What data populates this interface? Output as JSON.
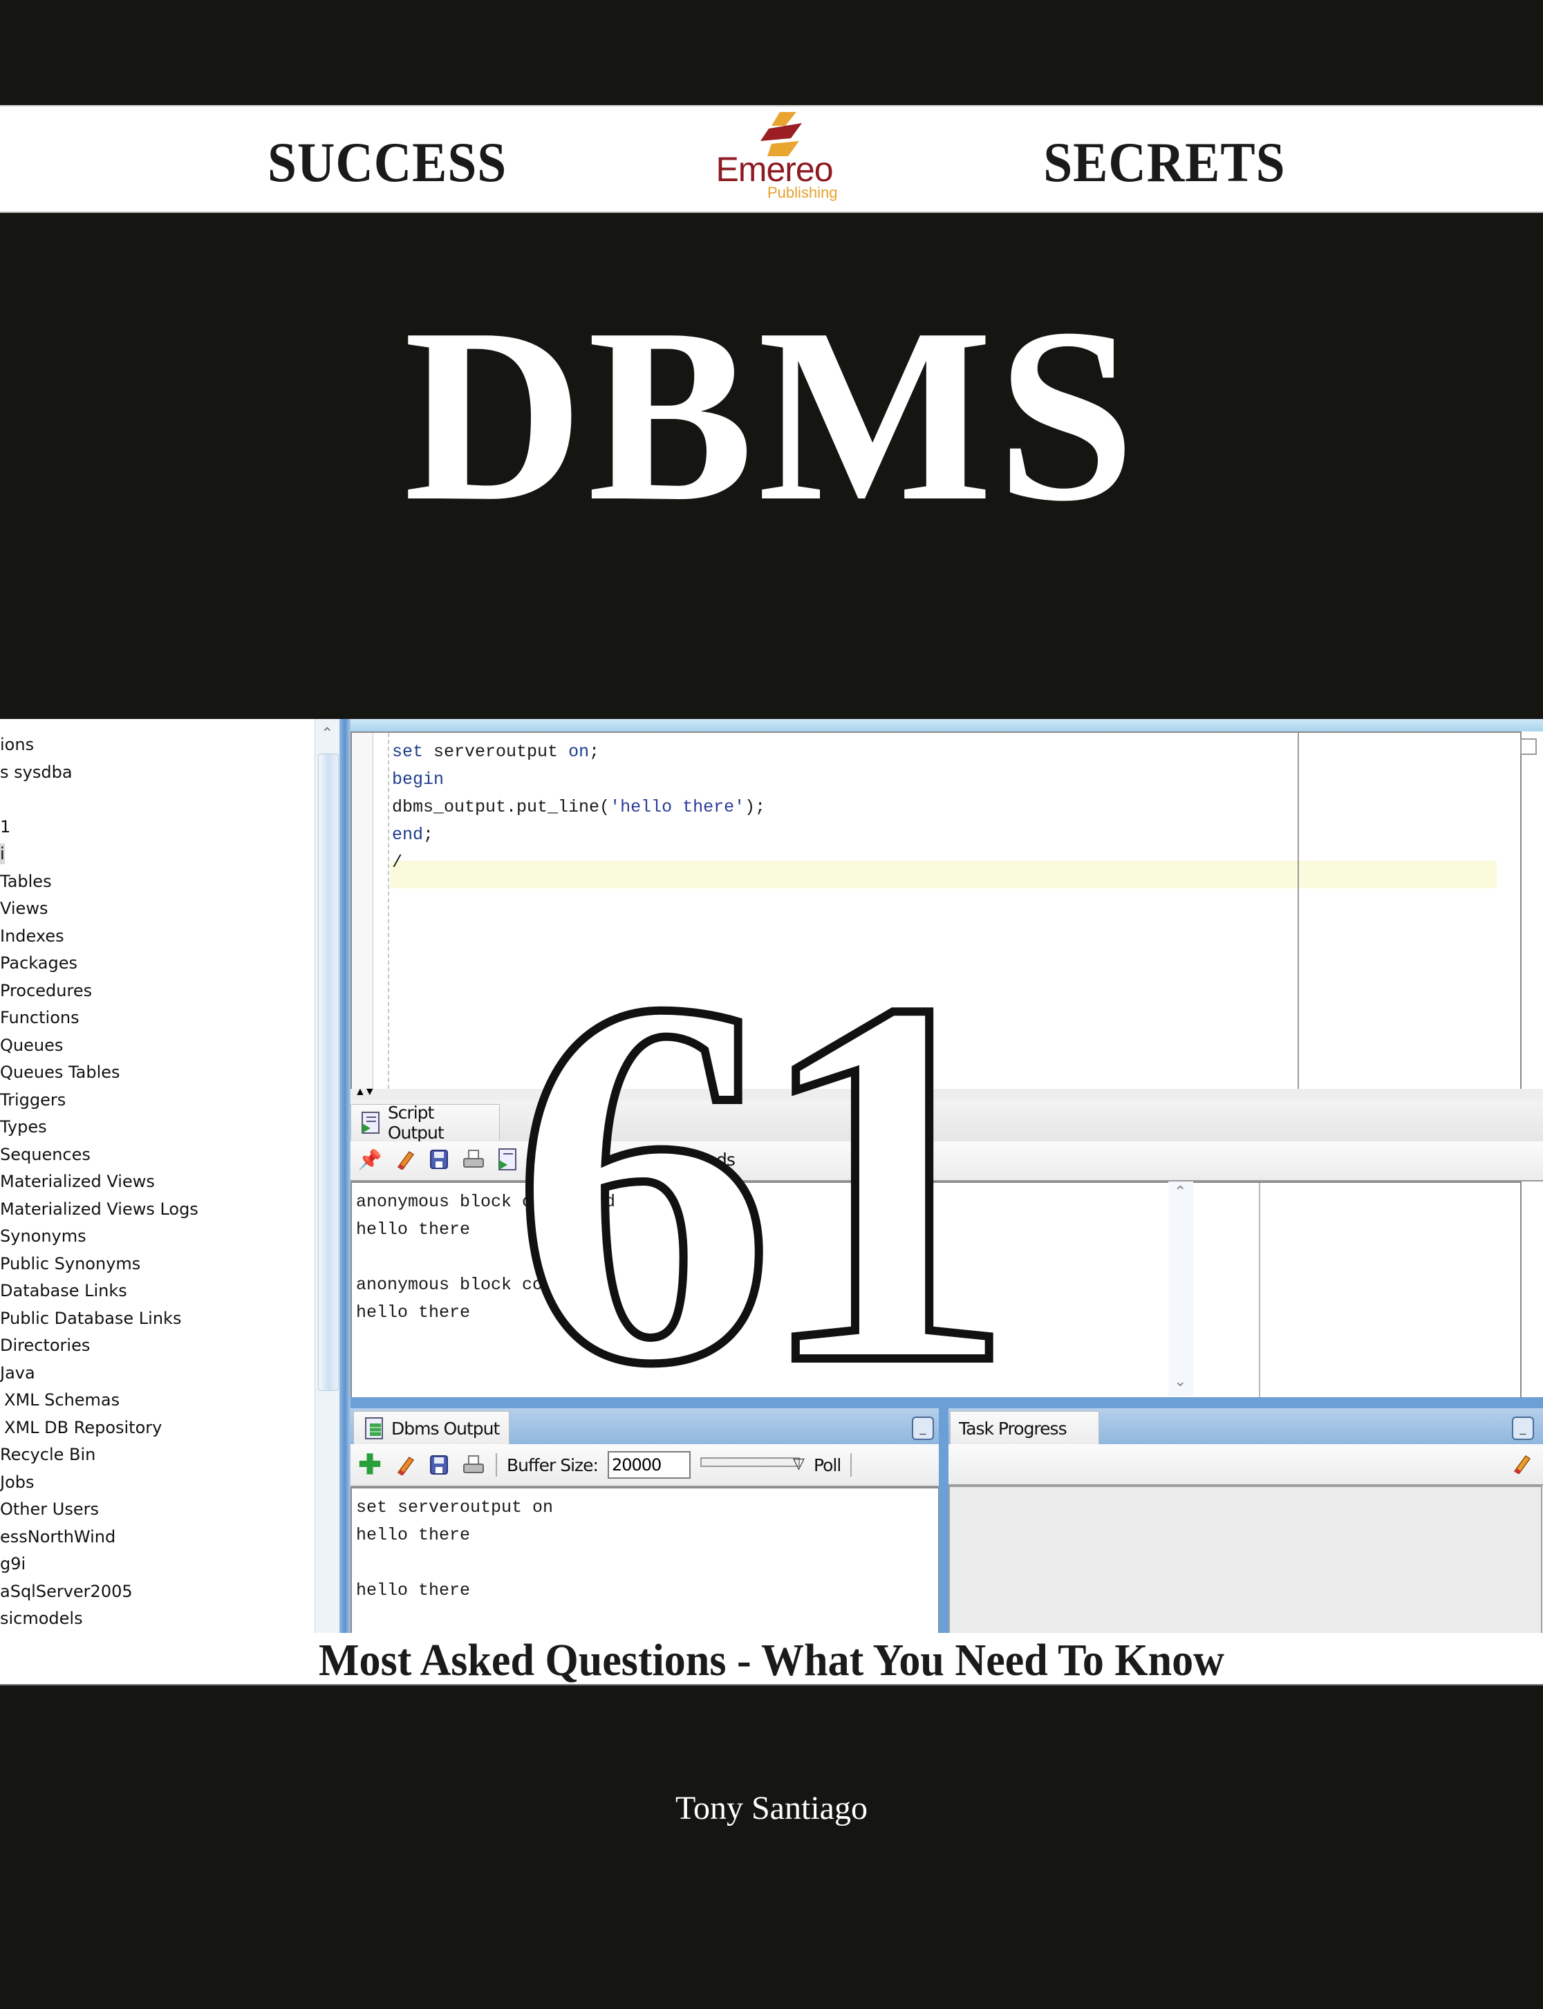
{
  "banner": {
    "left_word": "SUCCESS",
    "right_word": "SECRETS",
    "logo": {
      "name": "Emereo",
      "sub": "Publishing",
      "icon": "flame-stripes-logo",
      "colors": {
        "primary": "#8e1a22",
        "accent": "#e6a12c"
      }
    }
  },
  "title": "DBMS",
  "number": "61",
  "subtitle": "Most Asked Questions - What You Need To Know",
  "author": "Tony Santiago",
  "colors": {
    "background": "#151512",
    "ide_blue": "#6c9fd6"
  },
  "screenshot": {
    "tree_items": [
      {
        "label": "ions",
        "indent": 0
      },
      {
        "label": "s sysdba",
        "indent": 0
      },
      {
        "label": "",
        "indent": 0
      },
      {
        "label": "1",
        "indent": 0
      },
      {
        "label": "i",
        "indent": 0,
        "selected": true
      },
      {
        "label": "Tables",
        "indent": 1
      },
      {
        "label": "Views",
        "indent": 1
      },
      {
        "label": "Indexes",
        "indent": 1
      },
      {
        "label": "Packages",
        "indent": 1
      },
      {
        "label": "Procedures",
        "indent": 1
      },
      {
        "label": "Functions",
        "indent": 1
      },
      {
        "label": "Queues",
        "indent": 1
      },
      {
        "label": "Queues Tables",
        "indent": 1
      },
      {
        "label": "Triggers",
        "indent": 1
      },
      {
        "label": "Types",
        "indent": 1
      },
      {
        "label": "Sequences",
        "indent": 1
      },
      {
        "label": "Materialized Views",
        "indent": 1
      },
      {
        "label": "Materialized Views Logs",
        "indent": 1
      },
      {
        "label": "Synonyms",
        "indent": 1
      },
      {
        "label": "Public Synonyms",
        "indent": 1
      },
      {
        "label": "Database Links",
        "indent": 1
      },
      {
        "label": "Public Database Links",
        "indent": 1
      },
      {
        "label": "Directories",
        "indent": 1
      },
      {
        "label": "Java",
        "indent": 1
      },
      {
        "label": "XML Schemas",
        "indent": 2
      },
      {
        "label": "XML DB Repository",
        "indent": 2
      },
      {
        "label": "Recycle Bin",
        "indent": 1
      },
      {
        "label": "Jobs",
        "indent": 1
      },
      {
        "label": "Other Users",
        "indent": 1
      },
      {
        "label": "essNorthWind",
        "indent": 0
      },
      {
        "label": "g9i",
        "indent": 0
      },
      {
        "label": "aSqlServer2005",
        "indent": 0
      },
      {
        "label": "sicmodels",
        "indent": 0
      }
    ],
    "editor_lines": [
      {
        "parts": [
          {
            "t": "set ",
            "c": "kw"
          },
          {
            "t": "serveroutput ",
            "c": ""
          },
          {
            "t": "on",
            "c": "kw"
          },
          {
            "t": ";",
            "c": ""
          }
        ]
      },
      {
        "parts": [
          {
            "t": "begin",
            "c": "kw"
          }
        ]
      },
      {
        "parts": [
          {
            "t": "dbms_output.put_line(",
            "c": ""
          },
          {
            "t": "'hello there'",
            "c": "str"
          },
          {
            "t": ");",
            "c": ""
          }
        ]
      },
      {
        "parts": [
          {
            "t": "end",
            "c": "kw"
          },
          {
            "t": ";",
            "c": ""
          }
        ]
      },
      {
        "parts": [
          {
            "t": "/",
            "c": ""
          }
        ]
      }
    ],
    "script_output": {
      "tab_label": "Script Output",
      "status": "Task completed in 0 seconds",
      "status_visible": "T        leted in 0 seconds",
      "toolbar_icons": [
        "pin-icon",
        "eraser-icon",
        "save-icon",
        "print-icon",
        "run-script-icon"
      ],
      "lines": [
        "anonymous block completed",
        "hello there",
        "",
        "anonymous block completed",
        "hello there"
      ]
    },
    "dbms_output": {
      "tab_label": "Dbms Output",
      "toolbar_icons": [
        "add-icon",
        "eraser-icon",
        "save-icon",
        "print-icon"
      ],
      "buffer_label": "Buffer Size:",
      "buffer_value": "20000",
      "poll_label": "Poll",
      "lines": [
        "set serveroutput on",
        "hello there",
        "",
        "hello there"
      ]
    },
    "task_progress": {
      "tab_label": "Task Progress",
      "minimize_label": "_"
    }
  }
}
